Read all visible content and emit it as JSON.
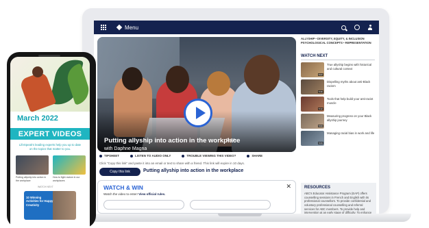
{
  "laptop": {
    "topbar": {
      "menu_label": "Menu"
    },
    "video": {
      "title": "Putting allyship into action in the workplace",
      "duration": "6m24s",
      "subtitle": "with Daphne Magna"
    },
    "tools": [
      {
        "label": "TIPSHEET"
      },
      {
        "label": "LISTEN TO AUDIO ONLY"
      },
      {
        "label": "TROUBLE VIEWING THIS VIDEO?"
      },
      {
        "label": "SHARE"
      }
    ],
    "share_note": "Click \"Copy this link\" and paste it into an email or text to share with a friend. This link will expire in 10 days.",
    "copy_button": "Copy this link",
    "copy_title": "Putting allyship into action in the workplace",
    "watch_win": {
      "title": "WATCH & WIN",
      "text": "Watch the video to enter!",
      "link": "View official rules."
    },
    "breadcrumb": "ALLYSHIP • DIVERSITY, EQUITY, & INCLUSION PSYCHOLOGICAL CONCEPTS • REPRESENTATION",
    "watch_next": {
      "heading": "WATCH NEXT",
      "items": [
        {
          "text": "True allyship begins with historical and cultural context",
          "time": "5:27"
        },
        {
          "text": "Dispelling myths about anti-Black racism",
          "time": "5:36"
        },
        {
          "text": "Tools that help build your anti-racist muscle",
          "time": "5:12"
        },
        {
          "text": "Measuring progress on your Black allyship journey",
          "time": "5:00"
        },
        {
          "text": "Managing racial bias in work and life",
          "time": "5:09"
        }
      ]
    },
    "resources": {
      "title": "RESOURCES",
      "text": "ABC's Educator Assistance Program (EAP) offers counselling sessions in French and English with its professional counsellors. To provide confidential and voluntary professional counselling and referral services for ABC members. To provide help and intervention at an early stage of difficulty. To enhance the health and"
    }
  },
  "phone": {
    "month": "March 2022",
    "banner": "EXPERT VIDEOS",
    "description": "LifeSpeak's leading experts help you up to date on the topics that matter to you.",
    "cards": [
      {
        "caption": "Putting allyship into action in the workplace"
      },
      {
        "caption": "How to fight racism in our workplaces"
      }
    ],
    "small_label": "WATCH NEXT",
    "feature_title": "10 Winning Activities for Happy Creativity"
  },
  "colors": {
    "navy": "#14224f",
    "accent_blue": "#2a63d4",
    "teal": "#1fb5c1"
  }
}
